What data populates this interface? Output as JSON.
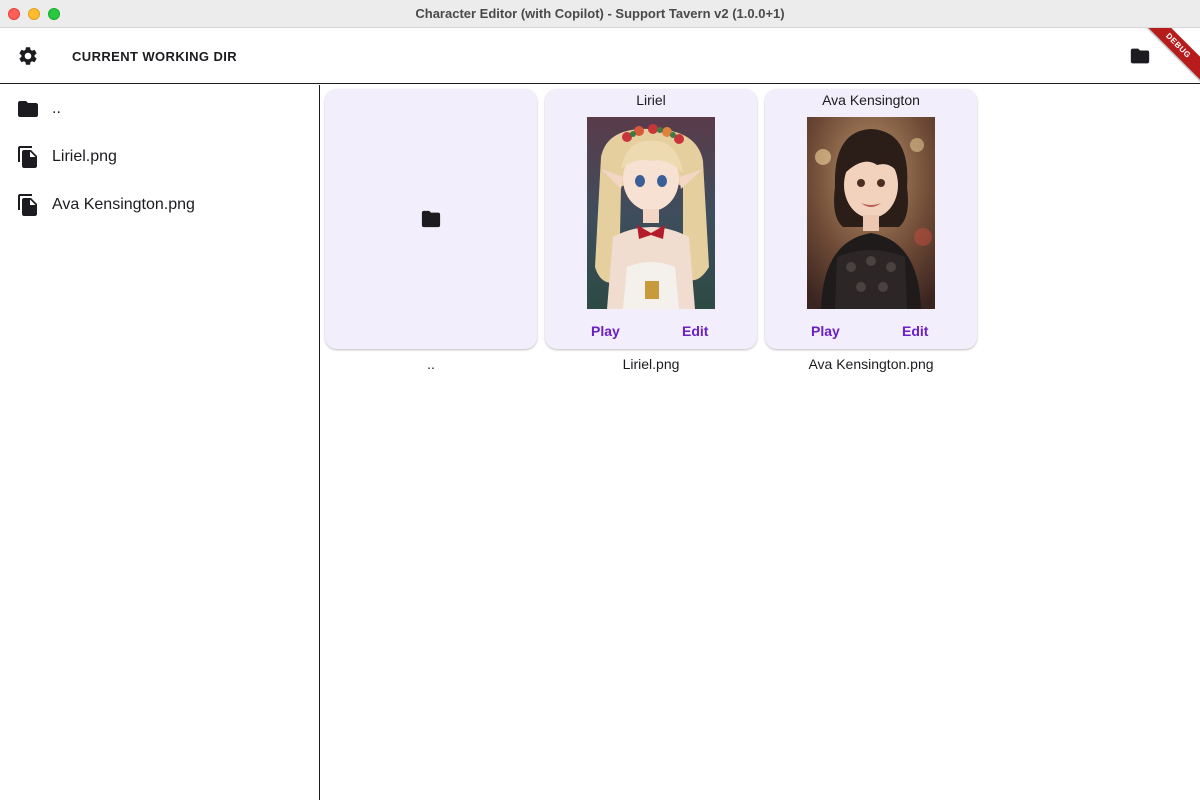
{
  "window": {
    "title": "Character Editor (with Copilot) - Support Tavern v2 (1.0.0+1)"
  },
  "appbar": {
    "title": "CURRENT WORKING DIR",
    "settings_icon": "gear-icon",
    "open_folder_icon": "folder-icon",
    "debug_banner": "DEBUG"
  },
  "sidebar": {
    "items": [
      {
        "label": "..",
        "icon": "folder-icon"
      },
      {
        "label": "Liriel.png",
        "icon": "file-copy-icon"
      },
      {
        "label": "Ava Kensington.png",
        "icon": "file-copy-icon"
      }
    ]
  },
  "grid": {
    "tiles": [
      {
        "type": "folder",
        "caption": "..",
        "icon": "folder-icon"
      },
      {
        "type": "character",
        "name": "Liriel",
        "caption": "Liriel.png",
        "play_label": "Play",
        "edit_label": "Edit"
      },
      {
        "type": "character",
        "name": "Ava Kensington",
        "caption": "Ava Kensington.png",
        "play_label": "Play",
        "edit_label": "Edit"
      }
    ]
  },
  "colors": {
    "accent": "#6a1fc7",
    "card_background": "#f3eefb",
    "debug_banner": "#b71c1c"
  }
}
